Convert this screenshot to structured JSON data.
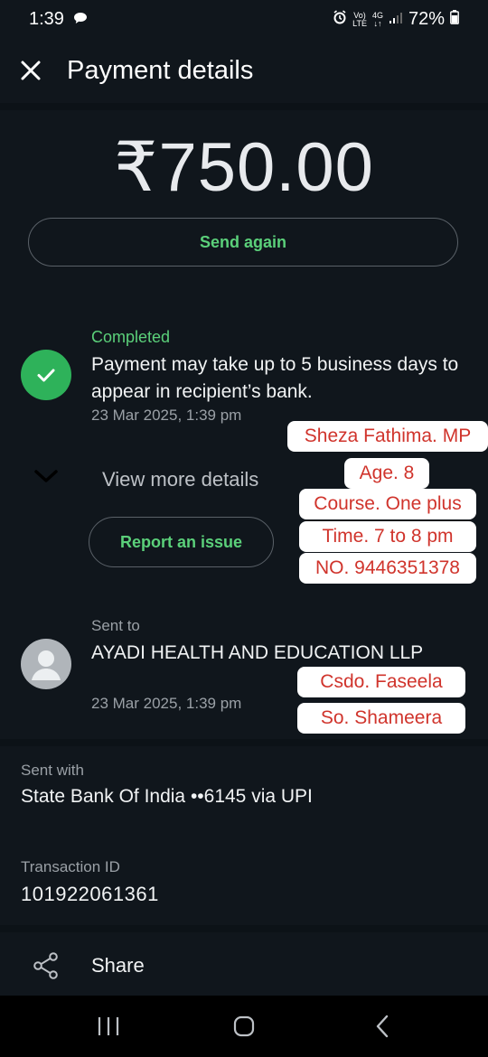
{
  "status_bar": {
    "time": "1:39",
    "network_top": "Vo)",
    "network_bottom": "LTE",
    "signal_top": "4G",
    "signal_bottom": "↓↑",
    "battery": "72%"
  },
  "header": {
    "title": "Payment details"
  },
  "amount": "₹750.00",
  "actions": {
    "send_again": "Send again",
    "report_issue": "Report an issue",
    "view_more": "View more details",
    "share": "Share"
  },
  "status": {
    "label": "Completed",
    "message": "Payment may take up to 5 business days to appear in recipient’s bank.",
    "date": "23 Mar 2025, 1:39 pm"
  },
  "recipient": {
    "label": "Sent to",
    "name": "AYADI HEALTH AND EDUCATION LLP",
    "date": "23 Mar 2025, 1:39 pm"
  },
  "sent_with": {
    "label": "Sent with",
    "value": "State Bank Of India ••6145 via UPI"
  },
  "transaction": {
    "label": "Transaction ID",
    "value": "101922061361"
  },
  "notes": {
    "line1": "Sheza Fathima. MP",
    "line2": "Age. 8",
    "line3": "Course. One plus",
    "line4": "Time. 7 to 8 pm",
    "line5": "NO. 9446351378",
    "line6": "Csdo. Faseela",
    "line7": "So. Shameera"
  },
  "colors": {
    "accent_green": "#5bd07a",
    "success_circle": "#2eb25a",
    "background": "#10161c",
    "note_text": "#d0342c"
  }
}
